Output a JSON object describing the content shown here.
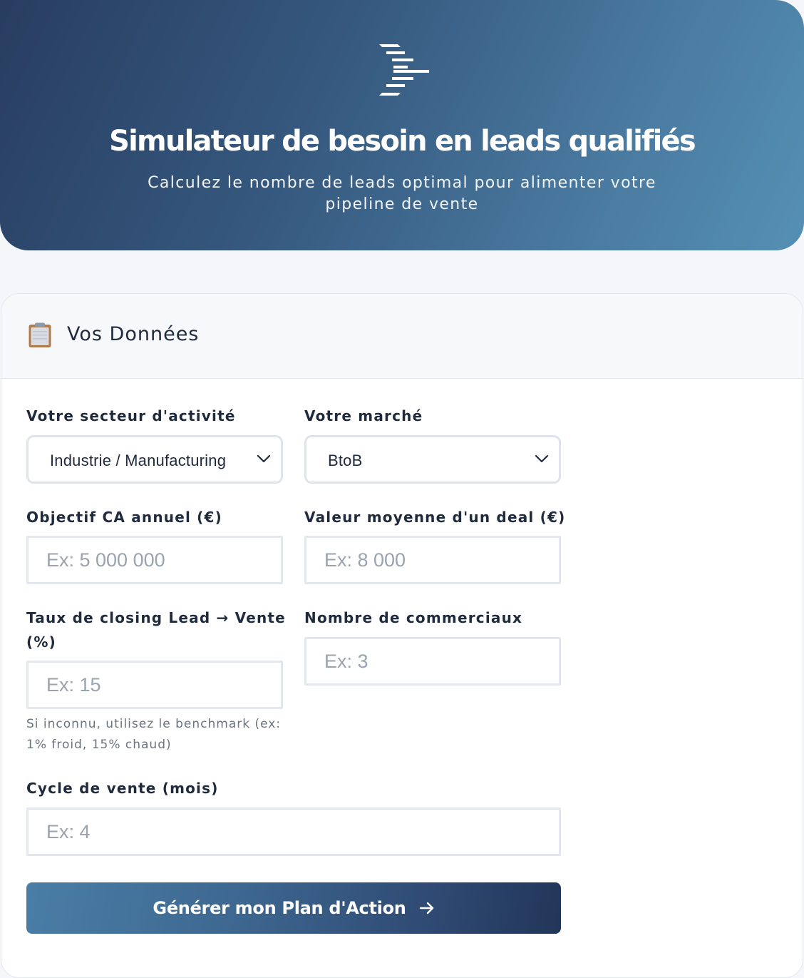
{
  "header": {
    "title": "Simulateur de besoin en leads qualifiés",
    "subtitle": "Calculez le nombre de leads optimal pour alimenter votre pipeline de vente",
    "logo_icon": "stacked-lines-logo-icon"
  },
  "card": {
    "icon": "clipboard-icon",
    "title": "Vos Données"
  },
  "form": {
    "sector": {
      "label": "Votre secteur d'activité",
      "value": "Industrie / Manufacturing"
    },
    "market": {
      "label": "Votre marché",
      "value": "BtoB"
    },
    "revenue_goal": {
      "label": "Objectif CA annuel (€)",
      "placeholder": "Ex: 5 000 000"
    },
    "deal_value": {
      "label": "Valeur moyenne d'un deal (€)",
      "placeholder": "Ex: 8 000"
    },
    "closing_rate": {
      "label": "Taux de closing Lead → Vente (%)",
      "placeholder": "Ex: 15",
      "helper": "Si inconnu, utilisez le benchmark (ex: 1% froid, 15% chaud)"
    },
    "sales_reps": {
      "label": "Nombre de commerciaux",
      "placeholder": "Ex: 3"
    },
    "sales_cycle": {
      "label": "Cycle de vente (mois)",
      "placeholder": "Ex: 4"
    },
    "submit_label": "Générer mon Plan d'Action"
  },
  "colors": {
    "header_gradient_start": "#283d60",
    "header_gradient_end": "#5590b4",
    "button_gradient_start": "#4a7ea6",
    "button_gradient_end": "#223658",
    "page_background": "#f4f6f9"
  }
}
